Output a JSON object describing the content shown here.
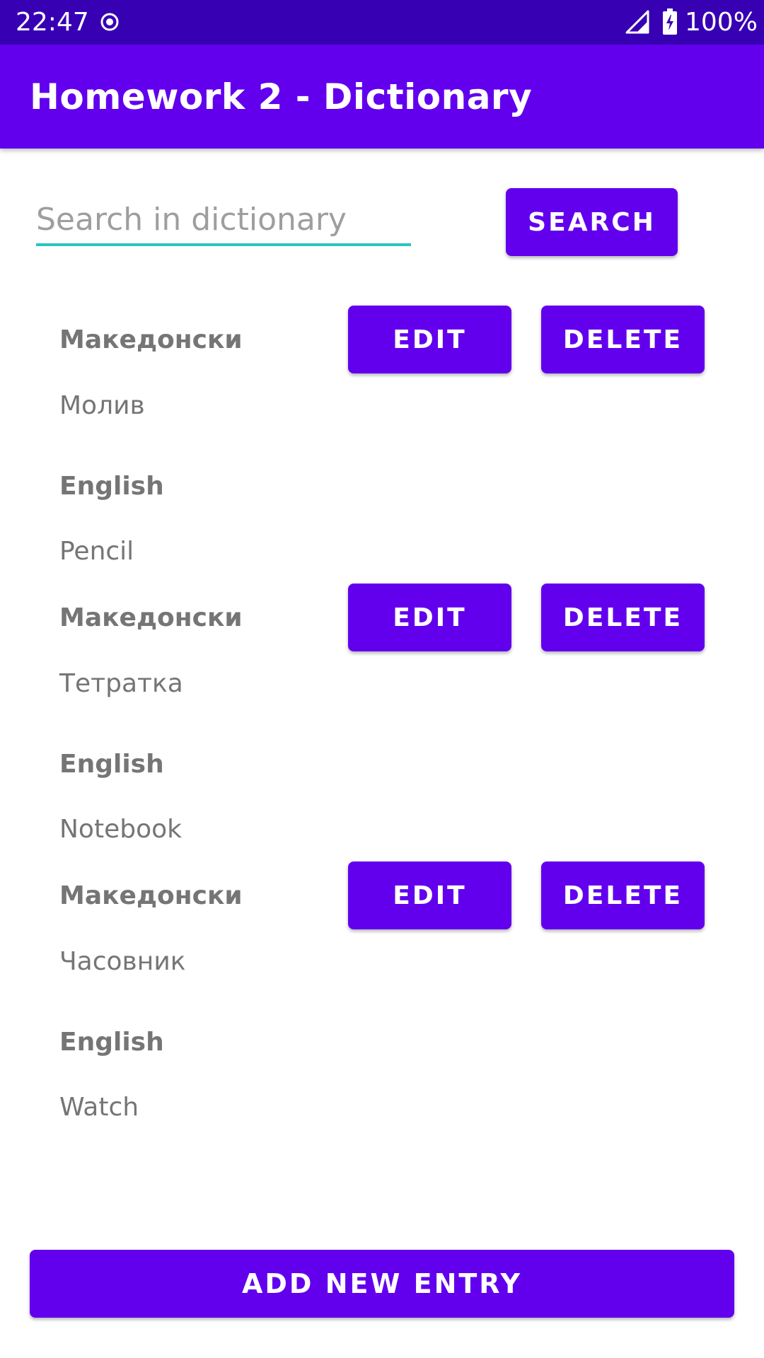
{
  "status_bar": {
    "time": "22:47",
    "battery_percent": "100%",
    "icons": [
      "record-icon",
      "signal-icon",
      "battery-charging-icon"
    ]
  },
  "app_bar": {
    "title": "Homework 2 - Dictionary"
  },
  "search": {
    "placeholder": "Search in dictionary",
    "value": "",
    "button_label": "SEARCH"
  },
  "entries": [
    {
      "mk_label": "Македонски",
      "mk_word": "Молив",
      "en_label": "English",
      "en_word": "Pencil",
      "edit_label": "EDIT",
      "delete_label": "DELETE"
    },
    {
      "mk_label": "Македонски",
      "mk_word": "Тетратка",
      "en_label": "English",
      "en_word": "Notebook",
      "edit_label": "EDIT",
      "delete_label": "DELETE"
    },
    {
      "mk_label": "Македонски",
      "mk_word": "Часовник",
      "en_label": "English",
      "en_word": "Watch",
      "edit_label": "EDIT",
      "delete_label": "DELETE"
    }
  ],
  "add_button_label": "ADD NEW ENTRY",
  "colors": {
    "status_bar": "#3700b3",
    "primary": "#6200ee",
    "search_underline": "#26c6c0",
    "secondary_text": "#757575"
  }
}
